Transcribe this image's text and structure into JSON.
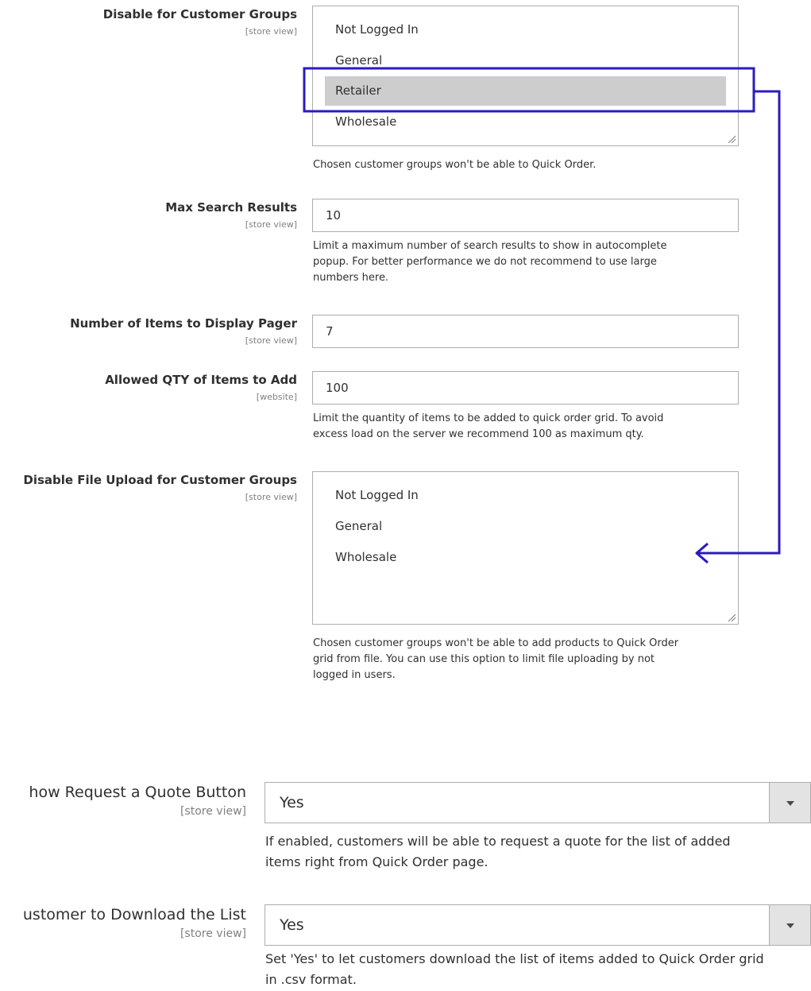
{
  "disable_customer_groups": {
    "label": "Disable for Customer Groups",
    "scope": "[store view]",
    "options": [
      {
        "label": "Not Logged In",
        "selected": false
      },
      {
        "label": "General",
        "selected": false
      },
      {
        "label": "Retailer",
        "selected": true
      },
      {
        "label": "Wholesale",
        "selected": false
      }
    ],
    "note": "Chosen customer groups won't be able to Quick Order."
  },
  "max_search_results": {
    "label": "Max Search Results",
    "scope": "[store view]",
    "value": "10",
    "note_lines": [
      "Limit a maximum number of search results to show in autocomplete",
      "popup. For better performance we do not recommend to use large",
      "numbers here."
    ]
  },
  "items_pager": {
    "label": "Number of Items to Display Pager",
    "scope": "[store view]",
    "value": "7"
  },
  "allowed_qty": {
    "label": "Allowed QTY of Items to Add",
    "scope": "[website]",
    "value": "100",
    "note_lines": [
      "Limit the quantity of items to be added to quick order grid. To avoid",
      "excess load on the server we recommend 100 as maximum qty."
    ]
  },
  "disable_file_upload": {
    "label": "Disable File Upload for Customer Groups",
    "scope": "[store view]",
    "options": [
      {
        "label": "Not Logged In",
        "selected": false
      },
      {
        "label": "General",
        "selected": false
      },
      {
        "label": "Wholesale",
        "selected": false
      }
    ],
    "note_lines": [
      "Chosen customer groups won't be able to add products to Quick Order",
      "grid from file. You can use this option to limit file uploading by not",
      "logged in users."
    ]
  },
  "request_quote": {
    "label": "how Request a Quote Button",
    "scope": "[store view]",
    "value": "Yes",
    "note_lines": [
      "If enabled, customers will be able to request a quote for the list of added",
      "items right from Quick Order page."
    ]
  },
  "download_list": {
    "label": "ustomer to Download the List",
    "scope": "[store view]",
    "value": "Yes",
    "note_lines": [
      "Set 'Yes' to let customers download the list of items added to Quick Order grid",
      "in .csv format."
    ]
  },
  "colors": {
    "annotation": "#2b1bbf",
    "selected_option_bg": "#cdcdcd",
    "border": "#adadad"
  }
}
